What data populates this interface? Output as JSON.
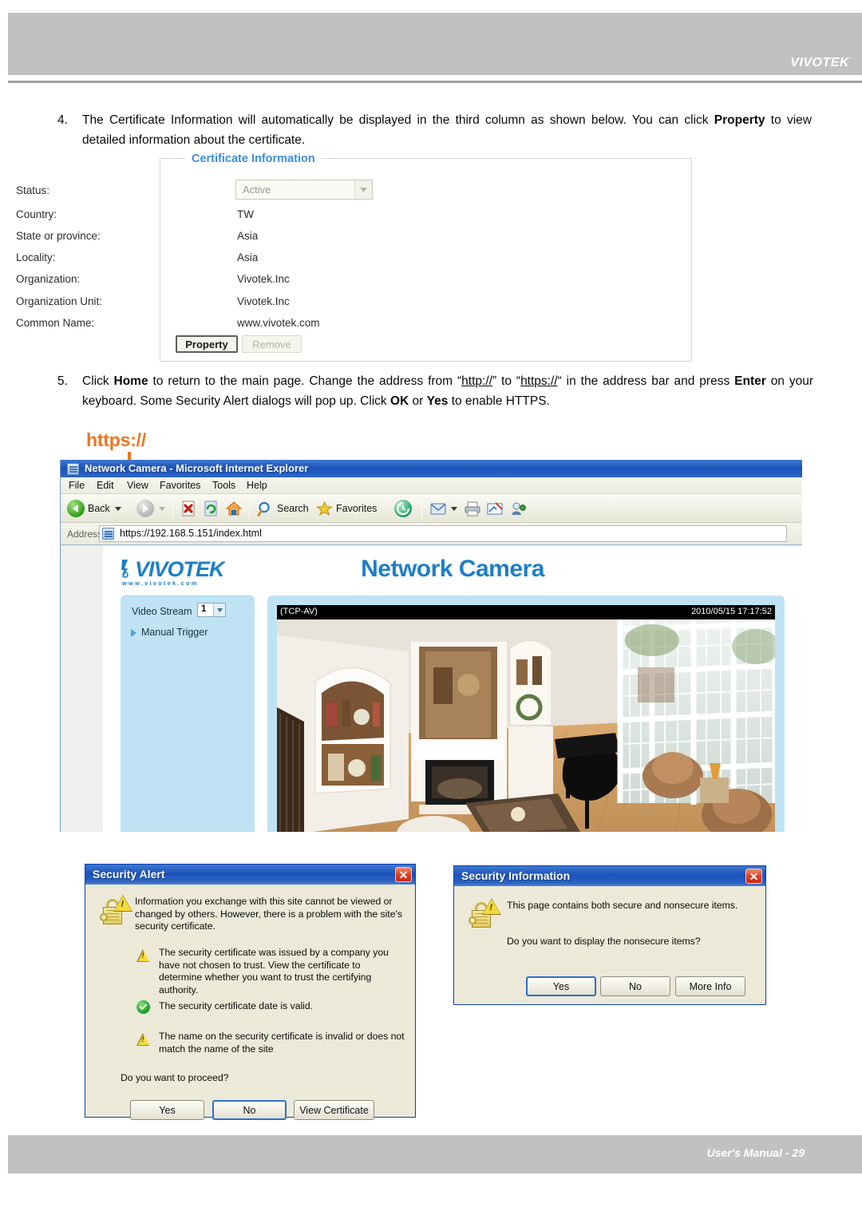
{
  "header": {
    "brand": "VIVOTEK"
  },
  "footer": {
    "text": "User's Manual - 29"
  },
  "steps": {
    "four": {
      "num": "4.",
      "part1": "The Certificate Information will automatically be displayed in the third column as shown below. You can click ",
      "bold1": "Property",
      "part2": " to view detailed information about the certificate."
    },
    "five": {
      "num": "5.",
      "p1": "Click ",
      "b1": "Home",
      "p2": " to return to the main page. Change the address from “",
      "link1": "http://",
      "p3": "” to “",
      "link2": "https://",
      "p4": "“ in the address bar and press ",
      "b2": "Enter",
      "p5": " on your keyboard. Some Security Alert dialogs will pop up. Click ",
      "b3": "OK",
      "p6": " or ",
      "b4": "Yes",
      "p7": " to enable HTTPS."
    }
  },
  "callout": {
    "label": "https://",
    "color": "#ef7521"
  },
  "certificate": {
    "legend": "Certificate Information",
    "rows": [
      {
        "label": "Status:",
        "value": "Active",
        "type": "select"
      },
      {
        "label": "Country:",
        "value": "TW",
        "type": "text"
      },
      {
        "label": "State or province:",
        "value": "Asia",
        "type": "text"
      },
      {
        "label": "Locality:",
        "value": "Asia",
        "type": "text"
      },
      {
        "label": "Organization:",
        "value": "Vivotek.Inc",
        "type": "text"
      },
      {
        "label": "Organization Unit:",
        "value": "Vivotek.Inc",
        "type": "text"
      },
      {
        "label": "Common Name:",
        "value": "www.vivotek.com",
        "type": "text"
      }
    ],
    "buttons": {
      "property": "Property",
      "remove": "Remove"
    }
  },
  "browser": {
    "title": "Network Camera - Microsoft Internet Explorer",
    "menus": [
      "File",
      "Edit",
      "View",
      "Favorites",
      "Tools",
      "Help"
    ],
    "toolbar": {
      "back": "Back",
      "search": "Search",
      "favorites": "Favorites",
      "icons": [
        "back-icon",
        "forward-icon",
        "stop-icon",
        "refresh-icon",
        "home-icon",
        "search-icon",
        "favorites-icon",
        "history-icon",
        "mail-icon",
        "print-icon",
        "edit-icon",
        "messenger-icon"
      ]
    },
    "address": {
      "label": "Address",
      "value": "https://192.168.5.151/index.html"
    }
  },
  "camera_page": {
    "logo_text": "VIVOTEK",
    "logo_url": "www.vivotek.com",
    "title": "Network Camera",
    "sidebar": {
      "video_stream_label": "Video Stream",
      "video_stream_value": "1",
      "manual_trigger": "Manual Trigger"
    },
    "osd": {
      "left": "(TCP-AV)",
      "right": "2010/05/15 17:17:52"
    }
  },
  "security_alert": {
    "title": "Security Alert",
    "close": "✕",
    "intro": "Information you exchange with this site cannot be viewed or changed by others. However, there is a problem with the site's security certificate.",
    "items": [
      {
        "icon": "warning-icon",
        "text": "The security certificate was issued by a company you have not chosen to trust. View the certificate to determine whether you want to trust the certifying authority."
      },
      {
        "icon": "check-icon",
        "text": "The security certificate date is valid."
      },
      {
        "icon": "warning-icon",
        "text": "The name on the security certificate is invalid or does not match the name of the site"
      }
    ],
    "question": "Do you want to proceed?",
    "buttons": [
      "Yes",
      "No",
      "View Certificate"
    ]
  },
  "security_information": {
    "title": "Security Information",
    "close": "✕",
    "line1": "This page contains both secure and nonsecure items.",
    "line2": "Do you want to display the nonsecure items?",
    "buttons": [
      "Yes",
      "No",
      "More Info"
    ]
  }
}
